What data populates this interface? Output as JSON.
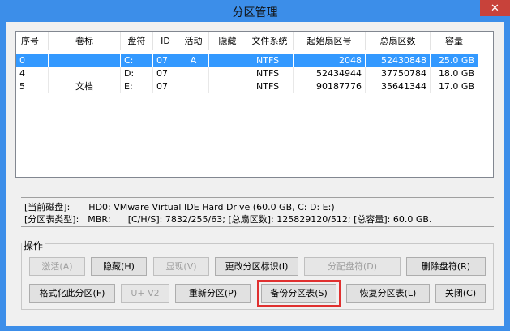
{
  "window": {
    "title": "分区管理",
    "close_glyph": "✕"
  },
  "table": {
    "columns": [
      "序号",
      "卷标",
      "盘符",
      "ID",
      "活动",
      "隐藏",
      "文件系统",
      "起始扇区号",
      "总扇区数",
      "容量"
    ],
    "rows": [
      [
        "0",
        "",
        "C:",
        "07",
        "A",
        "",
        "NTFS",
        "2048",
        "52430848",
        "25.0 GB"
      ],
      [
        "4",
        "",
        "D:",
        "07",
        "",
        "",
        "NTFS",
        "52434944",
        "37750784",
        "18.0 GB"
      ],
      [
        "5",
        "文档",
        "E:",
        "07",
        "",
        "",
        "NTFS",
        "90187776",
        "35641344",
        "17.0 GB"
      ]
    ],
    "selected_row": 0
  },
  "info": {
    "disk_label": "[当前磁盘]:",
    "disk_value": "HD0: VMware Virtual IDE Hard Drive (60.0 GB, C: D: E:)",
    "ptype_label": "[分区表类型]:",
    "ptype_value": "MBR;",
    "chs_text": "[C/H/S]: 7832/255/63; [总扇区数]: 125829120/512; [总容量]: 60.0 GB."
  },
  "operations": {
    "label": "操作",
    "buttons": {
      "activate": "激活(A)",
      "hide": "隐藏(H)",
      "show": "显现(V)",
      "change_id": "更改分区标识(I)",
      "assign_letter": "分配盘符(D)",
      "delete_letter": "删除盘符(R)",
      "format": "格式化此分区(F)",
      "uv2": "U+ V2",
      "repartition": "重新分区(P)",
      "backup_table": "备份分区表(S)",
      "restore_table": "恢复分区表(L)",
      "close": "关闭(C)"
    }
  },
  "colors": {
    "titlebar": "#3c8ee9",
    "selection": "#3399ff",
    "highlight": "#e0302f",
    "close": "#c8423a"
  }
}
